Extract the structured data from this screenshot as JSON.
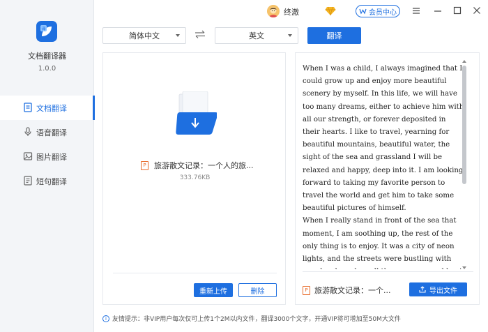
{
  "app": {
    "name": "文档翻译器",
    "version": "1.0.0",
    "accent": "#1e6fe0"
  },
  "sidebar": {
    "items": [
      {
        "label": "文档翻译",
        "icon": "document-icon",
        "active": true
      },
      {
        "label": "语音翻译",
        "icon": "microphone-icon",
        "active": false
      },
      {
        "label": "图片翻译",
        "icon": "image-icon",
        "active": false
      },
      {
        "label": "短句翻译",
        "icon": "text-icon",
        "active": false
      }
    ]
  },
  "titlebar": {
    "username": "终澈",
    "vip_label": "会员中心"
  },
  "toolbar": {
    "source_lang": "简体中文",
    "target_lang": "英文",
    "translate_label": "翻译"
  },
  "left_panel": {
    "file_name": "旅游散文记录：一个人的旅...",
    "file_size": "333.76KB",
    "reupload_label": "重新上传",
    "delete_label": "删除"
  },
  "right_panel": {
    "translated_text": "When I was a child, I always imagined that I could grow up and enjoy more beautiful scenery by myself. In this life, we will have too many dreams, either to achieve him with all our strength, or forever deposited in their hearts. I like to travel, yearning for beautiful mountains, beautiful water, the sight of the sea and grassland I will be relaxed and happy, deep into it. I am looking forward to taking my favorite person to travel the world and get him to take some beautiful pictures of himself.\nWhen I really stand in front of the sea that moment, I am soothing up, the rest of the only thing is to enjoy. It was a city of neon lights, and the streets were bustling with people who, when all the pressure could not be released, went into the arms of the sea. This kind of feeling hoped",
    "file_name": "旅游散文记录：一个...",
    "export_label": "导出文件"
  },
  "footer": {
    "tip": "友情提示：非VIP用户每次仅可上传1个2M以内文件，翻译3000个文字，开通VIP将可增加至50M大文件"
  }
}
